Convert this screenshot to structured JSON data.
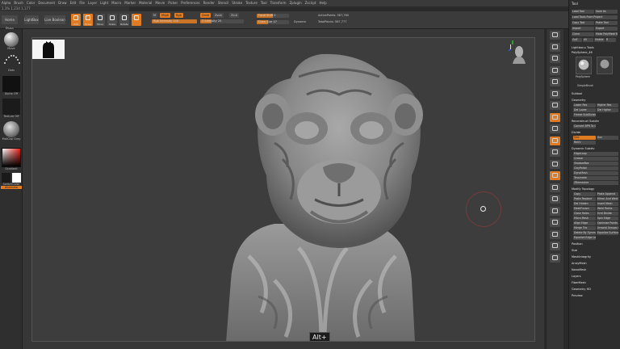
{
  "menu": [
    "Alpha",
    "Brush",
    "Color",
    "Document",
    "Draw",
    "Edit",
    "File",
    "Layer",
    "Light",
    "Macro",
    "Marker",
    "Material",
    "Movie",
    "Picker",
    "Preferences",
    "Render",
    "Stencil",
    "Stroke",
    "Texture",
    "Tool",
    "Transform",
    "Zplugin",
    "Zscript",
    "Help"
  ],
  "status_line": "1.3% 1,234 1,177",
  "shelf": {
    "home_page": "Home Page",
    "lightbox": "LightBox",
    "live_boolean": "Live Boolean",
    "tools": [
      {
        "label": "Edit",
        "on": true
      },
      {
        "label": "Draw",
        "on": true
      },
      {
        "label": "Move",
        "on": false
      },
      {
        "label": "Scale",
        "on": false
      },
      {
        "label": "Rotate",
        "on": false
      },
      {
        "label": "",
        "on": true
      }
    ],
    "mrgb": "Mrgb",
    "rgb": "Rgb",
    "m": "M",
    "zadd": "Zadd",
    "zsub": "Zsub",
    "zcut": "Zcut",
    "rgb_intensity": {
      "label": "Rgb Intensity 100",
      "value": 1.0
    },
    "z_intensity": {
      "label": "Z Intensity 25",
      "value": 0.25
    },
    "focal_shift": {
      "label": "Focal Shift 0",
      "value": 0.5
    },
    "draw_size": {
      "label": "Draw Size 47",
      "value": 0.35
    },
    "dynamic": "Dynamic",
    "active_points": "ActivePoints: 587,760",
    "total_points": "TotalPoints: 587,777"
  },
  "left_shelf": {
    "brush_label": "Move",
    "stroke_label": "Dots",
    "alpha_label": "Alpha Off",
    "texture_label": "Texture Off",
    "material_label": "MatCap Gray",
    "gradient_label": "Gradient",
    "switch_label": "SwitchColor",
    "alternate_label": "Alternate"
  },
  "overlay": {
    "key_label": "Alt+"
  },
  "palette": {
    "title": "Tool",
    "buttons": [
      [
        "Load Tool",
        "Save As"
      ],
      [
        "Load Tools From Project"
      ],
      [
        "Copy Tool",
        "Paste Tool"
      ],
      [
        "Import",
        "Export"
      ],
      [
        "Clone",
        "Make PolyMesh3D"
      ],
      [
        "GoZ",
        "All",
        "Visible",
        "R"
      ]
    ],
    "lightbox_tools": "Lightbox ▸ Tools",
    "polysphere": "PolySphere_48",
    "r_label": "R",
    "subtool_thumb": "PolySphere",
    "subtool_alt": "SimpleBrush",
    "sections": [
      {
        "name": "Subtool",
        "items": []
      },
      {
        "name": "Geometry",
        "items": [
          "Lower Res",
          "Higher Res",
          "Del Lower",
          "Del Higher",
          "Freeze SubDivision Levels"
        ]
      },
      {
        "name": "Reconstruct Subdiv",
        "items": [
          "Convert BPR To Geo"
        ]
      },
      {
        "name": "Divide",
        "items": [
          "Smt",
          "Suv",
          "ReUV"
        ]
      },
      {
        "name": "Dynamic Subdiv",
        "items": [
          "EdgeLoop",
          "Crease",
          "ShadowBox",
          "ClayPolish",
          "DynaMesh",
          "Tessimate",
          "ZRemesher"
        ]
      },
      {
        "name": "Modify Topology",
        "items": [
          "Copy",
          "Paste Append",
          "Paste Replace",
          "Mirror And Weld",
          "Del Hidden",
          "Insert Mesh",
          "MeshFusion",
          "Weld Points",
          "Close Holes",
          "Grid Divide",
          "Micro Mesh",
          "Spin Edge",
          "Align Edge",
          "Optimize Points",
          "Merge Tris",
          "Unweld Groups Border",
          "Delete By Symmetry",
          "Equalize Surface Area",
          "Equalize Edge Length"
        ]
      },
      {
        "name": "Position",
        "items": []
      },
      {
        "name": "Size",
        "items": []
      },
      {
        "name": "MeshIntegrity",
        "items": []
      },
      {
        "name": "ArrayMesh",
        "items": []
      },
      {
        "name": "NanoMesh",
        "items": []
      },
      {
        "name": "Layers",
        "items": []
      },
      {
        "name": "FiberMesh",
        "items": []
      },
      {
        "name": "Geometry HD",
        "items": []
      },
      {
        "name": "Preview",
        "items": []
      }
    ]
  },
  "colors": {
    "accent": "#e07b22",
    "canvas": "#3d3d3d",
    "sculpt": "#8a8a8a",
    "primary_color": "#ffffff",
    "secondary_color": "#1a1a1a"
  }
}
